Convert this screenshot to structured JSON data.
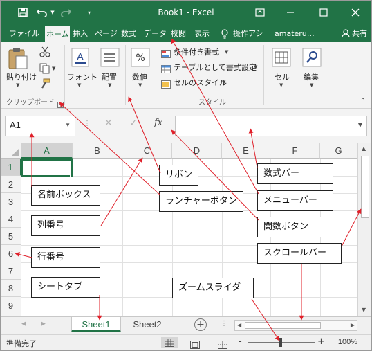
{
  "titlebar": {
    "doc_title": "Book1 - Excel",
    "quick_access": [
      "save-icon",
      "undo-icon",
      "redo-icon",
      "customize-icon"
    ],
    "window_buttons": [
      "ribbon-display-icon",
      "minimize-icon",
      "maximize-icon",
      "close-icon"
    ]
  },
  "menu": {
    "tabs": [
      "ファイル",
      "ホーム",
      "挿入",
      "ページ",
      "数式",
      "データ",
      "校閲",
      "表示",
      "操作アシ",
      "amateru…"
    ],
    "active": "ホーム",
    "share": "共有"
  },
  "ribbon": {
    "paste_label": "貼り付け",
    "clipboard_group": "クリップボード",
    "font_label": "フォント",
    "align_label": "配置",
    "number_label": "数値",
    "percent_symbol": "%",
    "font_glyph": "A",
    "styles_items": [
      "条件付き書式",
      "テーブルとして書式設定",
      "セルのスタイル"
    ],
    "styles_group": "スタイル",
    "cells_label": "セル",
    "edit_label": "編集"
  },
  "formula_bar": {
    "name_box": "A1",
    "cancel": "✕",
    "enter": "✓",
    "fx": "fx",
    "value": ""
  },
  "grid": {
    "columns": [
      "A",
      "B",
      "C",
      "D",
      "E",
      "F",
      "G"
    ],
    "rows": [
      "1",
      "2",
      "3",
      "4",
      "5",
      "6",
      "7",
      "8",
      "9"
    ],
    "selected_cell": "A1"
  },
  "sheets": {
    "tabs": [
      "Sheet1",
      "Sheet2"
    ],
    "active": "Sheet1",
    "add": "+"
  },
  "status": {
    "text": "準備完了",
    "zoom_minus": "-",
    "zoom_plus": "+",
    "zoom": "100%"
  },
  "annotations": {
    "ribbon": "リボン",
    "formula_bar": "数式バー",
    "name_box": "名前ボックス",
    "launcher": "ランチャーボタン",
    "menu_bar": "メニューバー",
    "column_header": "列番号",
    "function_button": "関数ボタン",
    "row_header": "行番号",
    "scroll_bar": "スクロールバー",
    "sheet_tab": "シートタブ",
    "zoom_slider": "ズームスライダ"
  },
  "colors": {
    "excel_green": "#217346",
    "ribbon_bg": "#f3f3f3",
    "arrow_red": "#e0202a"
  }
}
